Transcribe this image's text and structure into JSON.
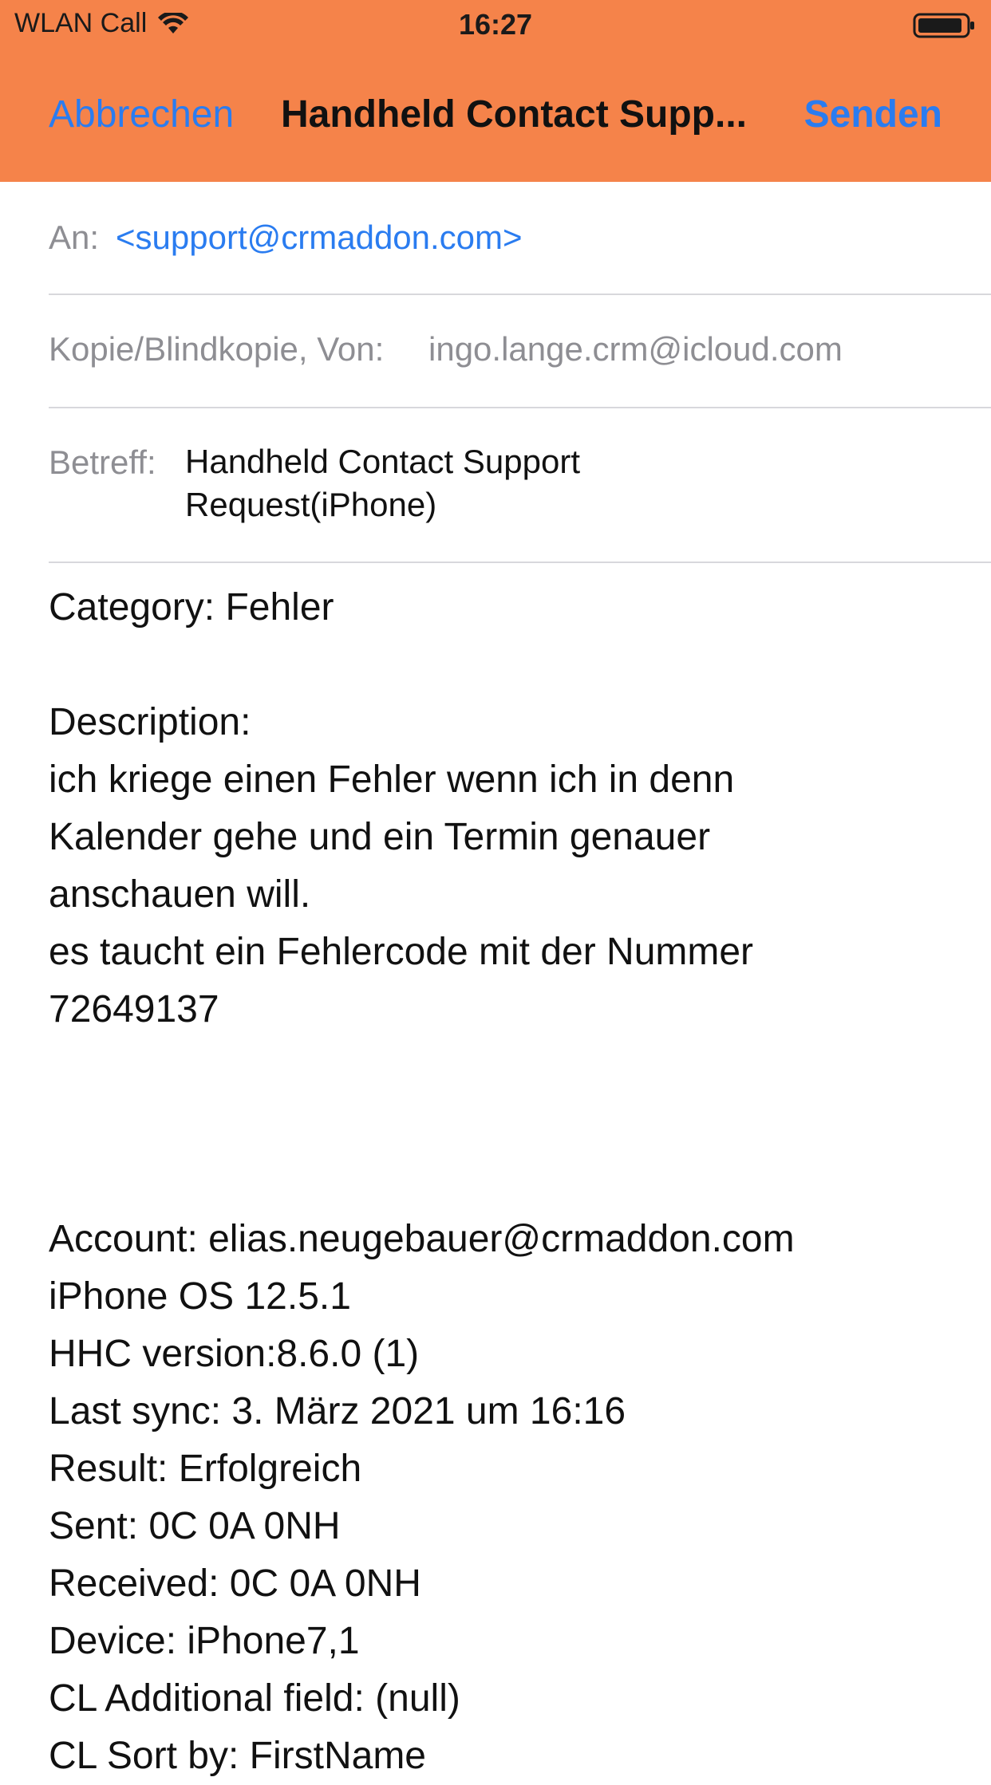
{
  "status_bar": {
    "carrier": "WLAN Call",
    "time": "16:27"
  },
  "nav": {
    "cancel_label": "Abbrechen",
    "title": "Handheld Contact Supp...",
    "send_label": "Senden"
  },
  "fields": {
    "to_label": "An:",
    "to_value": "<support@crmaddon.com>",
    "cc_label": "Kopie/Blindkopie, Von:",
    "cc_value": "ingo.lange.crm@icloud.com",
    "subject_label": "Betreff:",
    "subject_line1": "Handheld Contact Support",
    "subject_line2": "Request(iPhone)"
  },
  "body": {
    "category": "Category: Fehler",
    "description_label": "Description:",
    "description_lines": [
      "ich kriege einen Fehler wenn ich in denn",
      "Kalender gehe und ein Termin genauer",
      "anschauen will.",
      "es taucht ein Fehlercode mit der Nummer",
      "72649137"
    ],
    "info_lines": [
      "Account: elias.neugebauer@crmaddon.com",
      "iPhone OS 12.5.1",
      "HHC version:8.6.0 (1)",
      "Last sync: 3. März 2021 um 16:16",
      "Result: Erfolgreich",
      "Sent: 0C 0A 0NH",
      "Received: 0C 0A 0NH",
      "Device: iPhone7,1",
      "CL Additional field: (null)",
      "CL Sort by: FirstName"
    ]
  },
  "colors": {
    "header_bg": "#f5834a",
    "link_blue": "#2a7cf0",
    "label_gray": "#8e8e93"
  },
  "icons": [
    "wifi-icon",
    "battery-icon"
  ]
}
